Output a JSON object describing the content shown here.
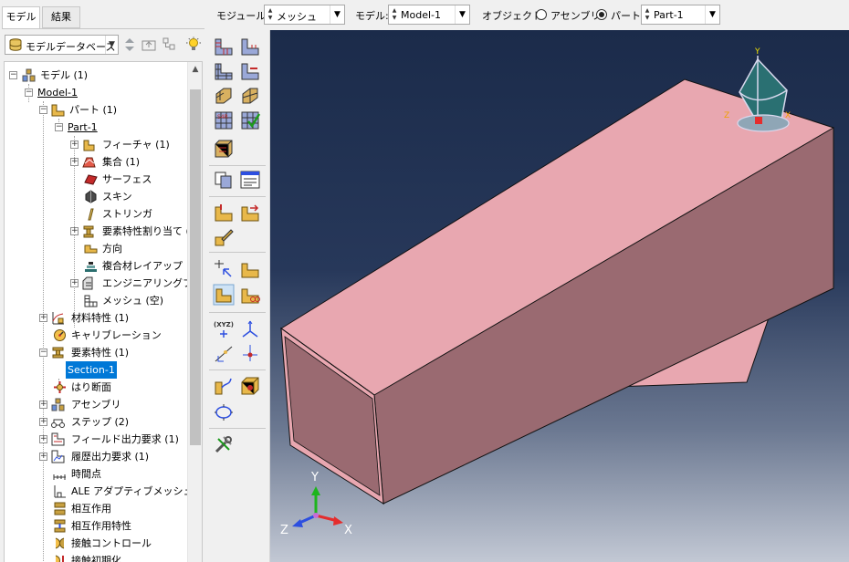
{
  "tabs": {
    "model": "モデル",
    "results": "結果"
  },
  "left_panel": {
    "db_combo": "モデルデータベース"
  },
  "tree": {
    "model_root": "モデル (1)",
    "model_1": "Model-1",
    "parts": "パート (1)",
    "part_1": "Part-1",
    "features": "フィーチャ (1)",
    "sets": "集合 (1)",
    "surfaces": "サーフェス",
    "skins": "スキン",
    "stringers": "ストリンガ",
    "section_assign": "要素特性割り当て (",
    "orientations": "方向",
    "composite_layups": "複合材レイアップ",
    "engineering_features": "エンジニアリングフィーチ",
    "mesh": "メッシュ (空)",
    "materials": "材料特性 (1)",
    "calibrations": "キャリブレーション",
    "sections": "要素特性 (1)",
    "section_1": "Section-1",
    "profiles": "はり断面",
    "assembly": "アセンブリ",
    "steps": "ステップ (2)",
    "field_output": "フィールド出力要求 (1)",
    "history_output": "履歴出力要求 (1)",
    "time_points": "時間点",
    "ale_constraints": "ALE アダプティブメッシュ拘束",
    "interactions": "相互作用",
    "interaction_props": "相互作用特性",
    "contact_controls": "接触コントロール",
    "contact_init": "接触初期化"
  },
  "topbar": {
    "module_label": "モジュール:",
    "module_value": "メッシュ",
    "model_label": "モデル:",
    "model_value": "Model-1",
    "object_label": "オブジェクト:",
    "assembly_label": "アセンブリ",
    "part_label": "パート:",
    "part_value": "Part-1",
    "object_selected": "part"
  },
  "viewport": {
    "triad": {
      "y": "Y",
      "x": "X",
      "z": "Z"
    },
    "csys": {
      "y": "Y",
      "x": "X",
      "z": "Z"
    },
    "colors": {
      "part_face": "#e8a7b0",
      "part_side": "#9a6a71",
      "triad_x": "#e42d2d",
      "triad_y": "#2db52d",
      "triad_z": "#2d4fe0"
    }
  }
}
